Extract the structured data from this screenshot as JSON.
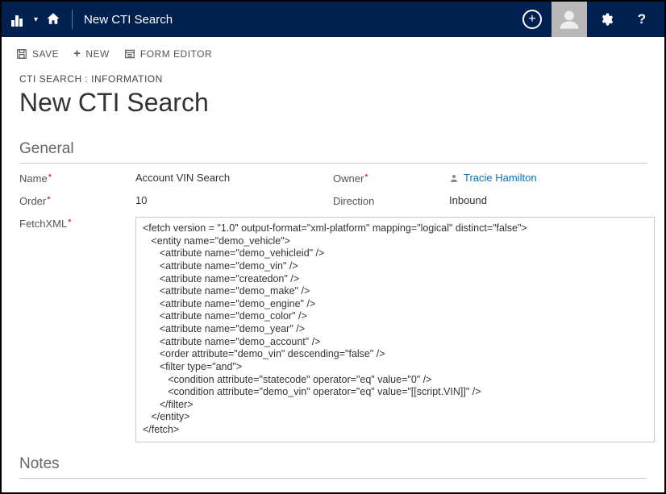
{
  "topbar": {
    "title": "New CTI Search",
    "add_label": "+",
    "gear_label": "⚙",
    "help_label": "?"
  },
  "toolbar": {
    "save_label": "SAVE",
    "new_label": "NEW",
    "form_editor_label": "FORM EDITOR"
  },
  "header": {
    "breadcrumb": "CTI SEARCH : INFORMATION",
    "title": "New CTI Search"
  },
  "sections": {
    "general": "General",
    "notes": "Notes"
  },
  "fields": {
    "name": {
      "label": "Name",
      "value": "Account VIN Search"
    },
    "order": {
      "label": "Order",
      "value": "10"
    },
    "fetchxml": {
      "label": "FetchXML"
    },
    "owner": {
      "label": "Owner",
      "value": "Tracie Hamilton"
    },
    "direction": {
      "label": "Direction",
      "value": "Inbound"
    }
  },
  "fetchxml_value": "<fetch version = \"1.0\" output-format=\"xml-platform\" mapping=\"logical\" distinct=\"false\">\n   <entity name=\"demo_vehicle\">\n      <attribute name=\"demo_vehicleid\" />\n      <attribute name=\"demo_vin\" />\n      <attribute name=\"createdon\" />\n      <attribute name=\"demo_make\" />\n      <attribute name=\"demo_engine\" />\n      <attribute name=\"demo_color\" />\n      <attribute name=\"demo_year\" />\n      <attribute name=\"demo_account\" />\n      <order attribute=\"demo_vin\" descending=\"false\" />\n      <filter type=\"and\">\n         <condition attribute=\"statecode\" operator=\"eq\" value=\"0\" />\n         <condition attribute=\"demo_vin\" operator=\"eq\" value=\"[[script.VIN]]\" />\n      </filter>\n   </entity>\n</fetch>"
}
